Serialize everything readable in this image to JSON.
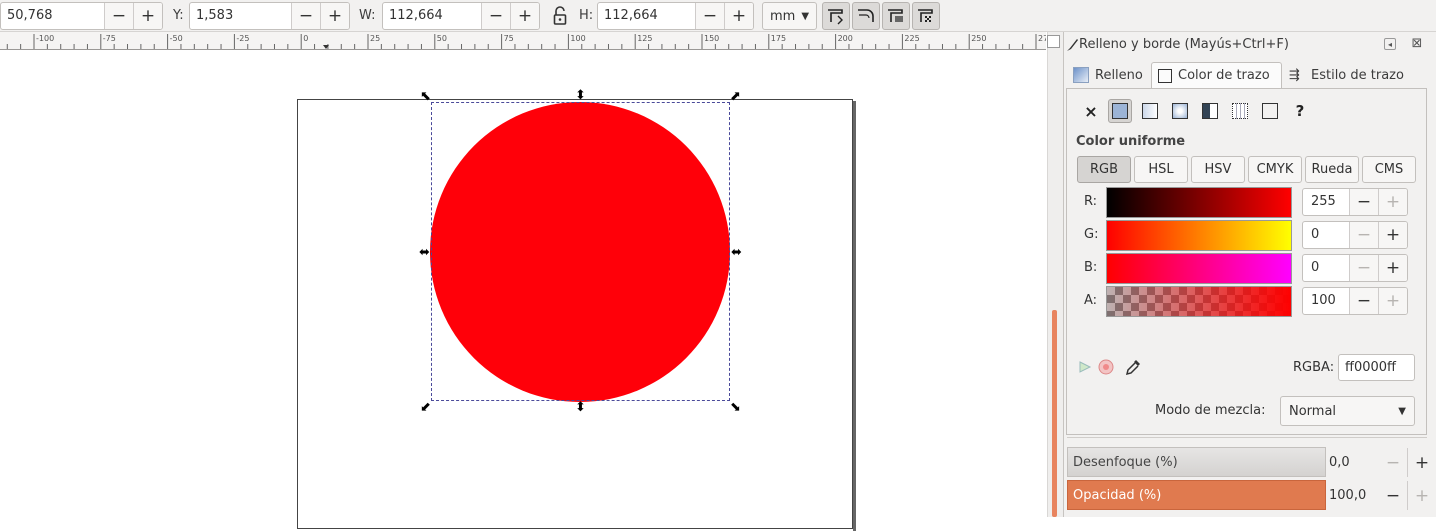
{
  "toolbar": {
    "x_value": "50,768",
    "y_label": "Y:",
    "y_value": "1,583",
    "w_label": "W:",
    "w_value": "112,664",
    "h_label": "H:",
    "h_value": "112,664",
    "unit": "mm",
    "minus": "−",
    "plus": "+"
  },
  "ruler": {
    "labels": [
      "-100",
      "-75",
      "-50",
      "-25",
      "0",
      "25",
      "50",
      "75",
      "100",
      "125",
      "150",
      "175",
      "200",
      "225",
      "250",
      "275"
    ]
  },
  "canvas": {
    "object_fill": "#ff0009"
  },
  "panel": {
    "title": "Relleno y borde (Mayús+Ctrl+F)",
    "tabs": [
      "Relleno",
      "Color de trazo",
      "Estilo de trazo"
    ],
    "paint_types": [
      "none-icon",
      "flat-color-icon",
      "linear-gradient-icon",
      "radial-gradient-icon",
      "pattern-icon",
      "swatch-icon",
      "unset-icon"
    ],
    "none_glyph": "×",
    "unset_glyph": "?",
    "section": "Color uniforme",
    "modes": [
      "RGB",
      "HSL",
      "HSV",
      "CMYK",
      "Rueda",
      "CMS"
    ],
    "channels": [
      {
        "label": "R:",
        "value": "255"
      },
      {
        "label": "G:",
        "value": "0"
      },
      {
        "label": "B:",
        "value": "0"
      },
      {
        "label": "A:",
        "value": "100"
      }
    ],
    "rgba_label": "RGBA:",
    "rgba_value": "ff0000ff",
    "blend_label": "Modo de mezcla:",
    "blend_value": "Normal",
    "blur_label": "Desenfoque (%)",
    "blur_value": "0,0",
    "opacity_label": "Opacidad (%)",
    "opacity_value": "100,0"
  },
  "colors": {
    "accent": "#e07a4f",
    "selection_box": "#4a4a9a"
  }
}
